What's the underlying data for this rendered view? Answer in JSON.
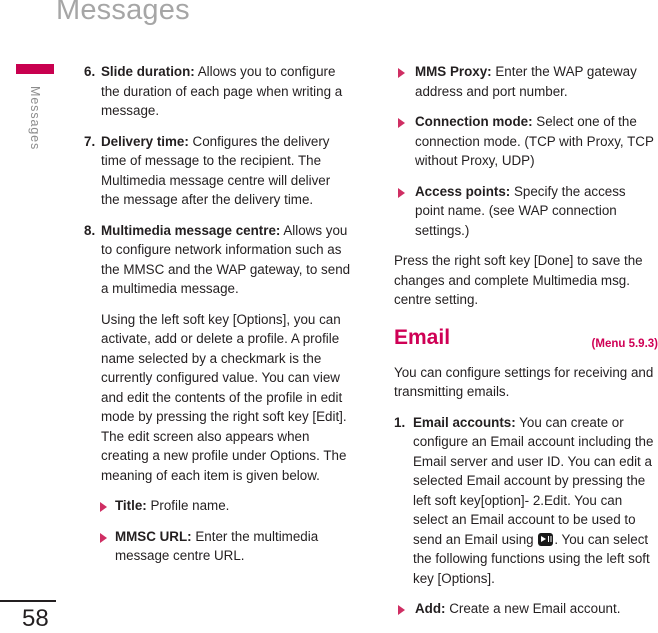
{
  "running_head": "Messages",
  "side_tab": {
    "label": "Messages",
    "bar_color": "#c8004f"
  },
  "footer": {
    "page_number": "58"
  },
  "colors": {
    "accent_pink": "#c8004f",
    "heading_pink": "#cf0055",
    "bullet_pink": "#cf2e63",
    "running_head_gray": "#a6a6a6",
    "body_text": "#231f20"
  },
  "left_column": {
    "items": [
      {
        "kind": "numitem",
        "number": "6.",
        "term": "Slide duration:",
        "text": " Allows you to configure the duration of each page when writing a message."
      },
      {
        "kind": "numitem",
        "number": "7.",
        "term": "Delivery time:",
        "text": " Configures the delivery time of message to the recipient. The Multimedia message centre will deliver the message after the delivery time."
      },
      {
        "kind": "numitem",
        "number": "8.",
        "term": "Multimedia message centre:",
        "text": " Allows  you to configure network information such as the MMSC and the WAP gateway, to send a multimedia message."
      },
      {
        "kind": "para",
        "text": "Using the left soft key [Options], you can activate, add or delete a profile. A profile name selected by a checkmark is the currently configured value. You can view and edit the contents of the profile in edit mode by pressing the right soft key [Edit]. The edit screen also appears when creating a new profile under Options. The meaning of each item is given below."
      },
      {
        "kind": "bullet",
        "term": "Title:",
        "text": " Profile name."
      },
      {
        "kind": "bullet",
        "term": "MMSC URL:",
        "text": " Enter the multimedia message centre URL."
      }
    ]
  },
  "right_column": {
    "items": [
      {
        "kind": "bullet",
        "term": "MMS Proxy:",
        "text": " Enter the WAP gateway address and port number."
      },
      {
        "kind": "bullet",
        "term": "Connection mode:",
        "text": " Select one of the connection mode. (TCP with Proxy, TCP without Proxy, UDP)"
      },
      {
        "kind": "bullet",
        "term": "Access points:",
        "text": " Specify the access point name. (see WAP connection settings.)"
      },
      {
        "kind": "para",
        "text": "Press the right soft key [Done] to save the changes and complete Multimedia msg. centre setting."
      }
    ],
    "section": {
      "title": "Email",
      "menu_ref": "(Menu 5.9.3)",
      "intro": "You can configure settings for receiving and transmitting emails.",
      "items": [
        {
          "kind": "numitem",
          "number": "1.",
          "term": "Email accounts:",
          "text_before_icon": " You can create or configure an Email account including the Email server and user ID. You can edit a selected Email account by pressing the left soft key[option]- 2.Edit. You can select an Email account to be used to send an Email using ",
          "icon": "ok-key-icon",
          "text_after_icon": ". You can select the following functions using the left soft key [Options]."
        },
        {
          "kind": "bullet",
          "term": "Add:",
          "text": " Create a new Email account."
        }
      ]
    }
  }
}
